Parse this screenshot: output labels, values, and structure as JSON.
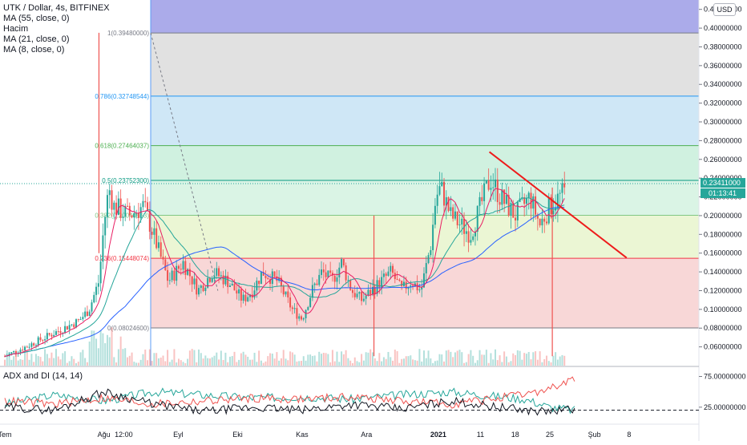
{
  "chart_data": {
    "type": "candlestick",
    "symbol_line": "UTK / Dollar, 4s, BITFINEX",
    "legend": [
      "MA (55, close, 0)",
      "Hacim",
      "MA (21, close, 0)",
      "MA (8, close, 0)"
    ],
    "currency_badge": "USD",
    "price_axis": {
      "ticks": [
        "0.42000000",
        "0.40000000",
        "0.38000000",
        "0.36000000",
        "0.34000000",
        "0.32000000",
        "0.30000000",
        "0.28000000",
        "0.26000000",
        "0.24000000",
        "0.22000000",
        "0.20000000",
        "0.18000000",
        "0.16000000",
        "0.14000000",
        "0.12000000",
        "0.10000000",
        "0.08000000",
        "0.06000000"
      ],
      "tick_values": [
        0.42,
        0.4,
        0.38,
        0.36,
        0.34,
        0.32,
        0.3,
        0.28,
        0.26,
        0.24,
        0.22,
        0.2,
        0.18,
        0.16,
        0.14,
        0.12,
        0.1,
        0.08,
        0.06
      ],
      "ylim": [
        0.04,
        0.43
      ]
    },
    "last_price": {
      "value": "0.23411000",
      "countdown": "01:13:41",
      "numeric": 0.23411
    },
    "time_axis": {
      "labels": [
        "Tem",
        "Ağu",
        "12:00",
        "Eyl",
        "Eki",
        "Kas",
        "Ara",
        "2021",
        "11",
        "18",
        "25",
        "Şub",
        "8"
      ],
      "positions": [
        0.0,
        0.2,
        0.24,
        0.35,
        0.47,
        0.6,
        0.73,
        0.875,
        0.96,
        1.03,
        1.1,
        1.19,
        1.26
      ]
    },
    "fibonacci": [
      {
        "label": "1(0.39480000)",
        "level": 1,
        "price": 0.3948,
        "color": "#787b86"
      },
      {
        "label": "0.786(0.32748544)",
        "level": 0.786,
        "price": 0.32748544,
        "color": "#2196f3"
      },
      {
        "label": "0.618(0.27464037)",
        "level": 0.618,
        "price": 0.27464037,
        "color": "#4caf50"
      },
      {
        "label": "0.5(0.23752300)",
        "level": 0.5,
        "price": 0.237523,
        "color": "#089981"
      },
      {
        "label": "0.382(0.20040563)",
        "level": 0.382,
        "price": 0.20040563,
        "color": "#81c784"
      },
      {
        "label": "0.236(0.15448074)",
        "level": 0.236,
        "price": 0.15448074,
        "color": "#f23645"
      },
      {
        "label": "0(0.08024600)",
        "level": 0,
        "price": 0.080246,
        "color": "#787b86"
      }
    ],
    "fib_bands": [
      {
        "from": 0.3948,
        "to": 0.43,
        "color": "#9c9ce6"
      },
      {
        "from": 0.32748544,
        "to": 0.3948,
        "color": "#dcdcdc"
      },
      {
        "from": 0.27464037,
        "to": 0.32748544,
        "color": "#c7e3f4"
      },
      {
        "from": 0.237523,
        "to": 0.27464037,
        "color": "#c8efdb"
      },
      {
        "from": 0.20040563,
        "to": 0.237523,
        "color": "#d3f2e0"
      },
      {
        "from": 0.15448074,
        "to": 0.20040563,
        "color": "#e8f5cc"
      },
      {
        "from": 0.080246,
        "to": 0.15448074,
        "color": "#f7d0d0"
      }
    ],
    "trendline": {
      "x": [
        0.978,
        1.255
      ],
      "y": [
        0.268,
        0.155
      ],
      "color": "#ee1b1b"
    },
    "price_path": {
      "x": [
        0.0,
        0.05,
        0.1,
        0.15,
        0.17,
        0.19,
        0.2,
        0.21,
        0.22,
        0.25,
        0.28,
        0.3,
        0.33,
        0.36,
        0.39,
        0.42,
        0.45,
        0.48,
        0.5,
        0.52,
        0.55,
        0.58,
        0.6,
        0.62,
        0.64,
        0.66,
        0.68,
        0.7,
        0.72,
        0.74,
        0.76,
        0.78,
        0.8,
        0.82,
        0.84,
        0.86,
        0.87,
        0.88,
        0.9,
        0.92,
        0.94,
        0.96,
        0.98,
        1.0,
        1.03,
        1.06,
        1.08,
        1.1,
        1.13
      ],
      "y": [
        0.05,
        0.062,
        0.075,
        0.088,
        0.1,
        0.13,
        0.19,
        0.23,
        0.21,
        0.2,
        0.21,
        0.18,
        0.13,
        0.15,
        0.12,
        0.14,
        0.13,
        0.11,
        0.12,
        0.14,
        0.13,
        0.1,
        0.09,
        0.12,
        0.14,
        0.13,
        0.15,
        0.12,
        0.11,
        0.12,
        0.13,
        0.14,
        0.12,
        0.13,
        0.12,
        0.17,
        0.22,
        0.23,
        0.2,
        0.19,
        0.18,
        0.21,
        0.24,
        0.22,
        0.2,
        0.22,
        0.19,
        0.21,
        0.225
      ]
    },
    "volume_axis_max": 1,
    "adx": {
      "title": "ADX and DI (14, 14)",
      "ticks": [
        "75.00000000",
        "25.00000000"
      ],
      "tick_values": [
        75,
        25
      ],
      "ylim": [
        0,
        90
      ],
      "dashed_level": 20,
      "series": [
        {
          "color": "#26a69a",
          "x": [
            0.0,
            0.1,
            0.2,
            0.3,
            0.4,
            0.5,
            0.6,
            0.7,
            0.8,
            0.9,
            1.0,
            1.05,
            1.1,
            1.15
          ],
          "y": [
            30,
            45,
            35,
            50,
            45,
            40,
            42,
            38,
            45,
            50,
            42,
            38,
            25,
            20
          ]
        },
        {
          "color": "#ef5350",
          "x": [
            0.0,
            0.1,
            0.2,
            0.3,
            0.4,
            0.5,
            0.6,
            0.7,
            0.8,
            0.9,
            1.0,
            1.05,
            1.1,
            1.15
          ],
          "y": [
            35,
            30,
            40,
            30,
            35,
            40,
            38,
            42,
            35,
            30,
            40,
            45,
            55,
            70
          ]
        },
        {
          "color": "#131722",
          "x": [
            0.0,
            0.1,
            0.2,
            0.3,
            0.4,
            0.5,
            0.6,
            0.7,
            0.8,
            0.9,
            1.0,
            1.05,
            1.1,
            1.15
          ],
          "y": [
            25,
            20,
            50,
            30,
            18,
            25,
            20,
            30,
            22,
            35,
            25,
            20,
            18,
            22
          ]
        }
      ]
    }
  }
}
